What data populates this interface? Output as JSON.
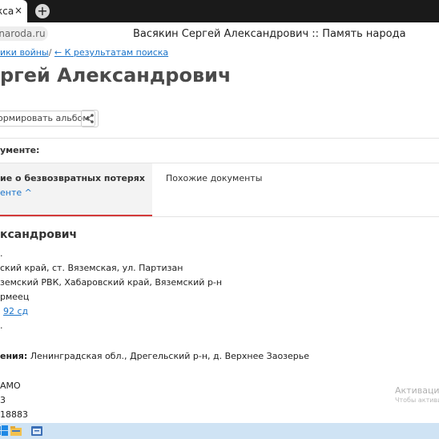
{
  "browser": {
    "tab_title": "кса",
    "tab_close": "×",
    "new_tab": "+",
    "url": "-naroda.ru",
    "window_title": "Васякин Сергей Александрович :: Память народа"
  },
  "breadcrumb": {
    "part1": "ики войны",
    "separator": "/",
    "back_link": "← К результатам поиска"
  },
  "page_title": "ргей Александрович",
  "actions": {
    "album_label": "ормировать альбом",
    "share_icon": "share-icon"
  },
  "doc_heading": "ументе:",
  "tabs": {
    "active_title": "ие о безвозвратных потерях",
    "active_sub": "енте ^",
    "similar": "Похожие документы"
  },
  "person": {
    "name": "ксандрович",
    "rows": [
      {
        "text": "."
      },
      {
        "text": "ский край, ст. Вяземская, ул. Партизан"
      },
      {
        "text": "земский РВК, Хабаровский край, Вяземский р-н"
      },
      {
        "text": "рмеец"
      },
      {
        "link": "92 сд"
      },
      {
        "text": "."
      },
      {
        "label": "ения:",
        "value": " Ленинградская обл., Дрегельский р-н, д. Верхнее Заозерье"
      },
      {
        "text": "АМО"
      },
      {
        "text": "3"
      },
      {
        "text": "18883"
      }
    ]
  },
  "watermark": {
    "line1": "Активация W",
    "line2": "Чтобы активир"
  },
  "taskbar": {
    "icons": [
      "windows-icon",
      "folder-icon",
      "browser-icon"
    ]
  }
}
